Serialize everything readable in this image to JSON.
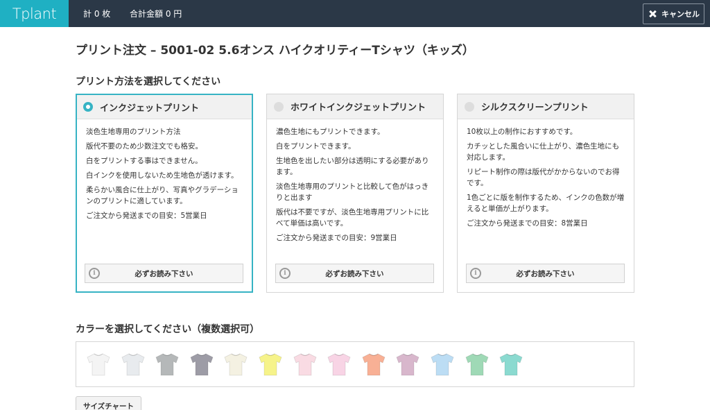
{
  "header": {
    "logo": "Tplant",
    "count_label": "計 0 枚",
    "total_label": "合計金額 0 円",
    "cancel_label": "キャンセル"
  },
  "page_title": "プリント注文 – 5001-02 5.6オンス ハイクオリティーTシャツ（キッズ）",
  "print_section_title": "プリント方法を選択してください",
  "print_methods": [
    {
      "name": "インクジェットプリント",
      "selected": true,
      "lines": [
        "淡色生地専用のプリント方法",
        "版代不要のため少数注文でも格安。",
        "白をプリントする事はできません。",
        "白インクを使用しないため生地色が透けます。",
        "柔らかい風合に仕上がり、写真やグラデーションのプリントに適しています。",
        "ご注文から発送までの目安：5営業日"
      ],
      "button": "必ずお読み下さい"
    },
    {
      "name": "ホワイトインクジェットプリント",
      "selected": false,
      "lines": [
        "濃色生地にもプリントできます。",
        "白をプリントできます。",
        "生地色を出したい部分は透明にする必要があります。",
        "淡色生地専用のプリントと比較して色がはっきりと出ます",
        "版代は不要ですが、淡色生地専用プリントに比べて単価は高いです。",
        "ご注文から発送までの目安：9営業日"
      ],
      "button": "必ずお読み下さい"
    },
    {
      "name": "シルクスクリーンプリント",
      "selected": false,
      "lines": [
        "10枚以上の制作におすすめです。",
        "カチッとした風合いに仕上がり、濃色生地にも対応します。",
        "リピート制作の際は版代がかからないのでお得です。",
        "1色ごとに版を制作するため、インクの色数が増えると単価が上がります。",
        "ご注文から発送までの目安：8営業日"
      ],
      "button": "必ずお読み下さい"
    }
  ],
  "color_section_title": "カラーを選択してください（複数選択可）",
  "colors": [
    "#f4f4f4",
    "#e8ebee",
    "#b5b8b9",
    "#9d9ca6",
    "#f4f1e2",
    "#f6f38a",
    "#f9dbe3",
    "#f8d4e5",
    "#f8b095",
    "#d8b7cc",
    "#bcddf4",
    "#9fd9b6",
    "#8bdad0"
  ],
  "size_chart_label": "サイズチャート"
}
